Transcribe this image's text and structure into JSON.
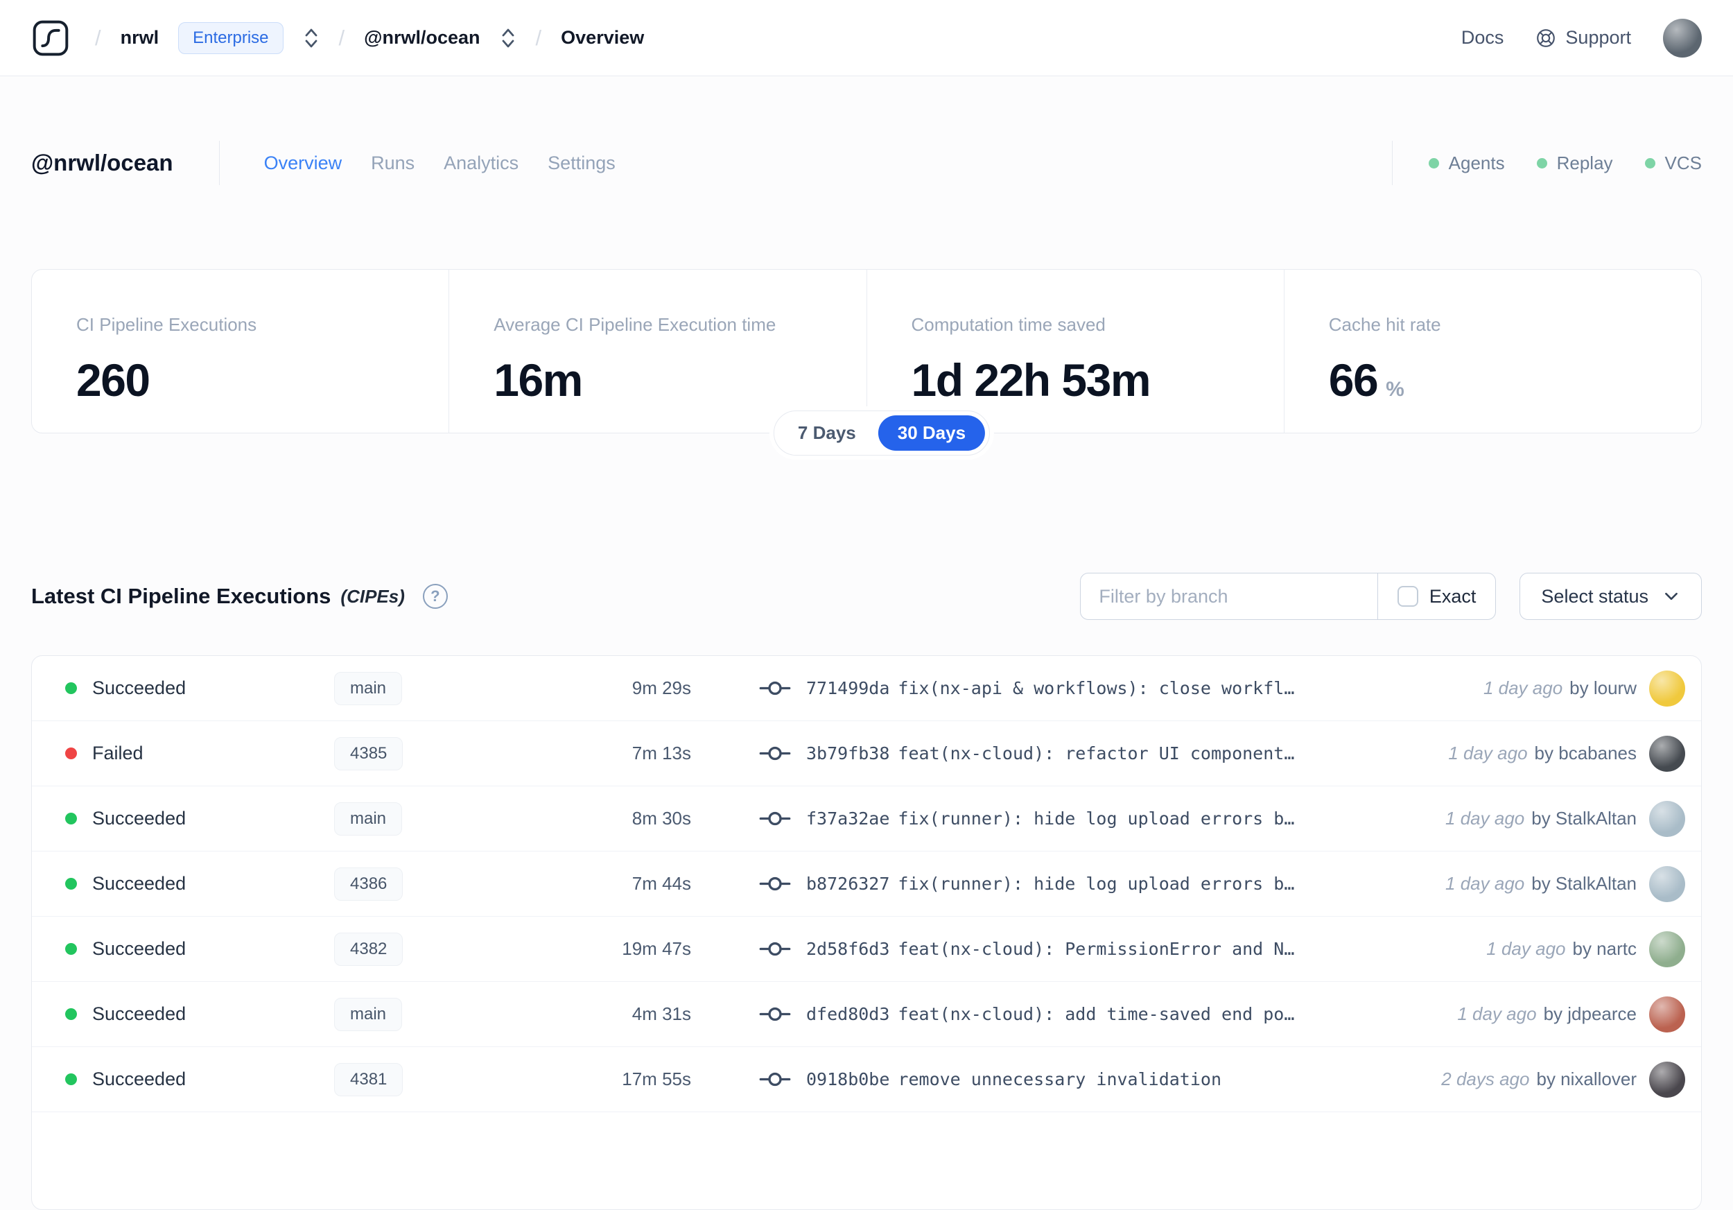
{
  "topnav": {
    "breadcrumb": {
      "separator": "/",
      "org": "nrwl",
      "org_badge": "Enterprise",
      "workspace": "@nrwl/ocean",
      "page": "Overview"
    },
    "docs_label": "Docs",
    "support_label": "Support",
    "user_avatar_color": "#5c6670"
  },
  "workspace_header": {
    "title": "@nrwl/ocean",
    "tabs": [
      {
        "label": "Overview",
        "active": true
      },
      {
        "label": "Runs",
        "active": false
      },
      {
        "label": "Analytics",
        "active": false
      },
      {
        "label": "Settings",
        "active": false
      }
    ],
    "features": [
      {
        "label": "Agents"
      },
      {
        "label": "Replay"
      },
      {
        "label": "VCS"
      }
    ],
    "feature_dot_color": "#7ed4a6"
  },
  "stats": {
    "cards": [
      {
        "label": "CI Pipeline Executions",
        "value": "260",
        "suffix": ""
      },
      {
        "label": "Average CI Pipeline Execution time",
        "value": "16m",
        "suffix": ""
      },
      {
        "label": "Computation time saved",
        "value": "1d 22h 53m",
        "suffix": ""
      },
      {
        "label": "Cache hit rate",
        "value": "66",
        "suffix": "%"
      }
    ],
    "range_options": [
      {
        "label": "7 Days",
        "active": false
      },
      {
        "label": "30 Days",
        "active": true,
        "color": "#2563eb"
      }
    ]
  },
  "cipes": {
    "title": "Latest CI Pipeline Executions",
    "title_note": "(CIPEs)",
    "help_glyph": "?",
    "filter_placeholder": "Filter by branch",
    "exact_label": "Exact",
    "exact_checked": false,
    "status_select_label": "Select status",
    "rows": [
      {
        "status": "Succeeded",
        "status_color": "#22c55e",
        "branch": "main",
        "duration": "9m 29s",
        "commit_hash": "771499da",
        "commit_message": "fix(nx-api & workflows): close workfl…",
        "time": "1 day ago",
        "author": "by lourw",
        "avatar_color": "#f0c93d"
      },
      {
        "status": "Failed",
        "status_color": "#ef4444",
        "branch": "4385",
        "duration": "7m 13s",
        "commit_hash": "3b79fb38",
        "commit_message": "feat(nx-cloud): refactor UI component…",
        "time": "1 day ago",
        "author": "by bcabanes",
        "avatar_color": "#454a50"
      },
      {
        "status": "Succeeded",
        "status_color": "#22c55e",
        "branch": "main",
        "duration": "8m 30s",
        "commit_hash": "f37a32ae",
        "commit_message": "fix(runner): hide log upload errors b…",
        "time": "1 day ago",
        "author": "by StalkAltan",
        "avatar_color": "#a9bcc8"
      },
      {
        "status": "Succeeded",
        "status_color": "#22c55e",
        "branch": "4386",
        "duration": "7m 44s",
        "commit_hash": "b8726327",
        "commit_message": "fix(runner): hide log upload errors b…",
        "time": "1 day ago",
        "author": "by StalkAltan",
        "avatar_color": "#a9bcc8"
      },
      {
        "status": "Succeeded",
        "status_color": "#22c55e",
        "branch": "4382",
        "duration": "19m 47s",
        "commit_hash": "2d58f6d3",
        "commit_message": "feat(nx-cloud): PermissionError and N…",
        "time": "1 day ago",
        "author": "by nartc",
        "avatar_color": "#8fae8e"
      },
      {
        "status": "Succeeded",
        "status_color": "#22c55e",
        "branch": "main",
        "duration": "4m 31s",
        "commit_hash": "dfed80d3",
        "commit_message": "feat(nx-cloud): add time-saved end po…",
        "time": "1 day ago",
        "author": "by jdpearce",
        "avatar_color": "#bb6250"
      },
      {
        "status": "Succeeded",
        "status_color": "#22c55e",
        "branch": "4381",
        "duration": "17m 55s",
        "commit_hash": "0918b0be",
        "commit_message": "remove unnecessary invalidation",
        "time": "2 days ago",
        "author": "by nixallover",
        "avatar_color": "#4a474d"
      }
    ]
  }
}
